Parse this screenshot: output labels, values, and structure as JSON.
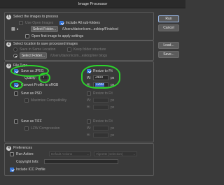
{
  "window": {
    "title": "Image Processor"
  },
  "buttons": {
    "run": "Run",
    "cancel": "Cancel",
    "load": "Load...",
    "save": "Save..."
  },
  "section1": {
    "number": "1",
    "title": "Select the images to process",
    "use_open_images": "Use Open Images",
    "include_subfolders": "Include All sub-folders",
    "select_folder": "Select Folder...",
    "folder_path": "/Users/darion/com...esktop/Finished",
    "open_first_image": "Open first image to apply settings"
  },
  "section2": {
    "number": "2",
    "title": "Select location to save processed images",
    "save_same_location": "Save in Same Location",
    "keep_folder_structure": "Keep folder structure",
    "select_folder": "Select Folder...",
    "folder_path": "/Users/darion/com...esktop/rev blogs"
  },
  "section3": {
    "number": "3",
    "title": "File Type",
    "save_jpeg": "Save as JPEG",
    "quality_label": "Quality:",
    "quality_value": "7",
    "convert_srgb": "Convert Profile to sRGB",
    "resize_fit_jpeg": "Resize to Fit",
    "w_label": "W:",
    "w_value": "2400",
    "h_label": "H:",
    "h_value": "1200",
    "px": "px",
    "save_psd": "Save as PSD",
    "maximize_compat": "Maximize Compatibility",
    "resize_fit_psd": "Resize to Fit",
    "save_tiff": "Save as TIFF",
    "lzw": "LZW Compression",
    "resize_fit_tiff": "Resize to Fit"
  },
  "section4": {
    "number": "4",
    "title": "Preferences",
    "run_action": "Run Action:",
    "action_set": "Default Actions",
    "action_name": "Vignette (selection)",
    "copyright_label": "Copyright Info:",
    "copyright_value": "",
    "include_icc": "Include ICC Profile"
  },
  "colors": {
    "annotation": "#2bd42b",
    "accent": "#2f6fd6"
  }
}
